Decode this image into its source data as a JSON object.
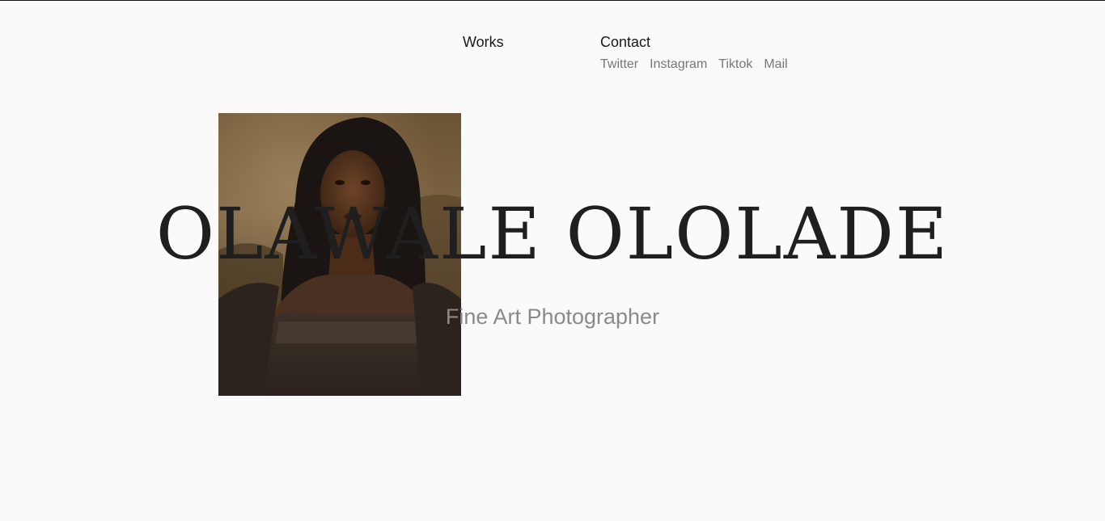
{
  "nav": {
    "works_label": "Works",
    "contact_title": "Contact",
    "social_links": [
      "Twitter",
      "Instagram",
      "Tiktok",
      "Mail"
    ]
  },
  "hero": {
    "name": "OLAWALE OLOLADE",
    "subtitle": "Fine Art Photographer"
  },
  "colors": {
    "background": "#fafafa",
    "text_primary": "#1f1f1f",
    "text_secondary": "#8a8a8a",
    "link": "#777777"
  }
}
